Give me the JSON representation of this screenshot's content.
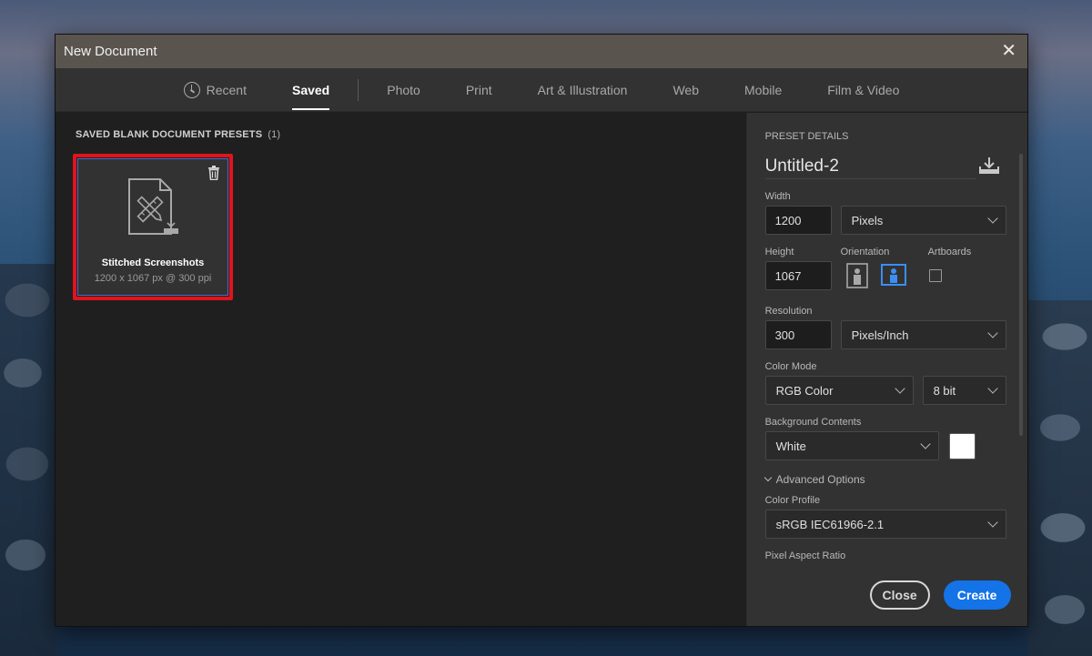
{
  "dialog": {
    "title": "New Document",
    "close_glyph": "✕"
  },
  "tabs": [
    {
      "label": "Recent",
      "icon": "clock-icon"
    },
    {
      "label": "Saved",
      "active": true
    },
    {
      "label": "Photo"
    },
    {
      "label": "Print"
    },
    {
      "label": "Art & Illustration"
    },
    {
      "label": "Web"
    },
    {
      "label": "Mobile"
    },
    {
      "label": "Film & Video"
    }
  ],
  "presets": {
    "section_title": "SAVED BLANK DOCUMENT PRESETS",
    "count": "(1)",
    "items": [
      {
        "name": "Stitched Screenshots",
        "spec": "1200 x 1067 px @ 300 ppi"
      }
    ]
  },
  "details": {
    "header": "PRESET DETAILS",
    "name": "Untitled-2",
    "width_label": "Width",
    "width_value": "1200",
    "width_unit": "Pixels",
    "height_label": "Height",
    "height_value": "1067",
    "orientation_label": "Orientation",
    "artboards_label": "Artboards",
    "resolution_label": "Resolution",
    "resolution_value": "300",
    "resolution_unit": "Pixels/Inch",
    "color_mode_label": "Color Mode",
    "color_mode": "RGB Color",
    "bit_depth": "8 bit",
    "background_label": "Background Contents",
    "background": "White",
    "background_swatch": "#ffffff",
    "advanced_label": "Advanced Options",
    "color_profile_label": "Color Profile",
    "color_profile": "sRGB IEC61966-2.1",
    "pixel_aspect_label": "Pixel Aspect Ratio"
  },
  "buttons": {
    "close": "Close",
    "create": "Create"
  },
  "colors": {
    "accent": "#1473e6",
    "selection_outline": "#e0141c",
    "orientation_active": "#3b8ef3"
  }
}
